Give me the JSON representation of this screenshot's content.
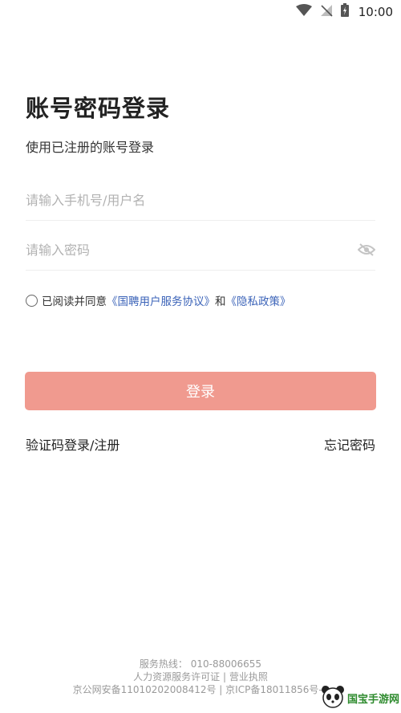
{
  "status_bar": {
    "time": "10:00"
  },
  "page": {
    "title": "账号密码登录",
    "subtitle": "使用已注册的账号登录"
  },
  "form": {
    "account_placeholder": "请输入手机号/用户名",
    "password_placeholder": "请输入密码"
  },
  "agreement": {
    "prefix": "已阅读并同意",
    "user_agreement": "《国聘用户服务协议》",
    "and": "和",
    "privacy_policy": "《隐私政策》"
  },
  "buttons": {
    "login": "登录",
    "sms_login": "验证码登录/注册",
    "forgot_password": "忘记密码"
  },
  "footer": {
    "line1": "服务热线：  010-88006655",
    "line2": "人力资源服务许可证 | 营业执照",
    "line3": "京公网安备11010202008412号 | 京ICP备18011856号-2"
  },
  "colors": {
    "login_button": "#f09a8f",
    "link": "#3b63b8",
    "footer_text": "#9a9a9a"
  },
  "icons": {
    "eye_toggle": "eye-off-icon",
    "wifi": "wifi-icon",
    "signal": "no-signal-icon",
    "battery": "battery-charging-icon"
  }
}
